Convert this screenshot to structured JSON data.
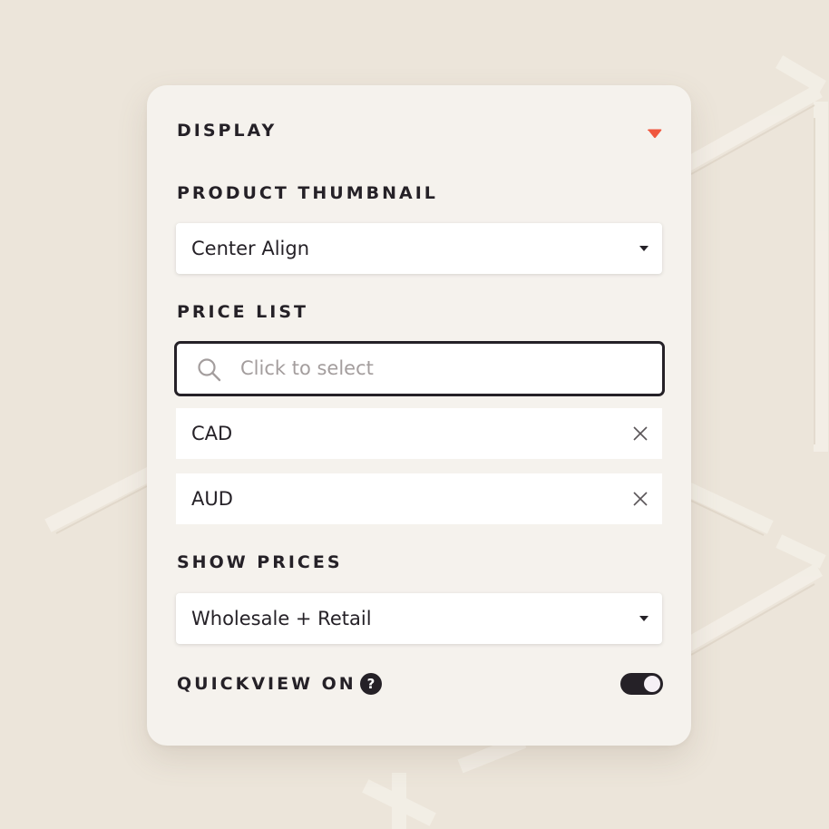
{
  "display": {
    "title": "DISPLAY",
    "collapse_icon": "caret-down-icon",
    "accent_color": "#f0573e"
  },
  "product_thumbnail": {
    "label": "PRODUCT THUMBNAIL",
    "selected": "Center Align"
  },
  "price_list": {
    "label": "PRICE LIST",
    "search_placeholder": "Click to select",
    "search_icon": "search-icon",
    "selected_items": [
      {
        "label": "CAD"
      },
      {
        "label": "AUD"
      }
    ]
  },
  "show_prices": {
    "label": "SHOW PRICES",
    "selected": "Wholesale + Retail"
  },
  "quickview": {
    "label": "QUICKVIEW ON",
    "help_glyph": "?",
    "enabled": true
  },
  "colors": {
    "background": "#ece5da",
    "panel": "#f5f2ed",
    "text": "#252127",
    "placeholder": "#a39d9d"
  }
}
